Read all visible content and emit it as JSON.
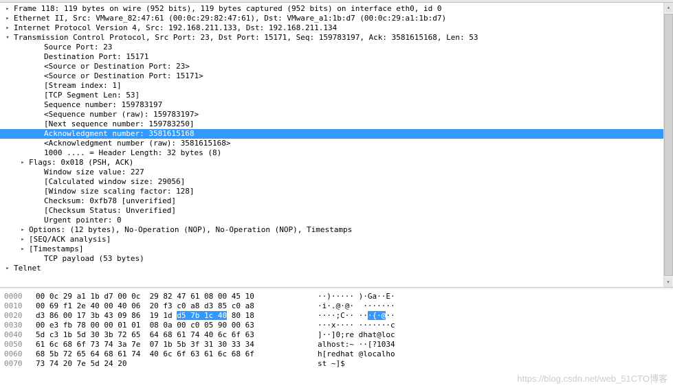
{
  "tree": [
    {
      "indent": 0,
      "toggle": "closed",
      "text": "Frame 118: 119 bytes on wire (952 bits), 119 bytes captured (952 bits) on interface eth0, id 0",
      "interact": true
    },
    {
      "indent": 0,
      "toggle": "closed",
      "text": "Ethernet II, Src: VMware_82:47:61 (00:0c:29:82:47:61), Dst: VMware_a1:1b:d7 (00:0c:29:a1:1b:d7)",
      "interact": true
    },
    {
      "indent": 0,
      "toggle": "closed",
      "text": "Internet Protocol Version 4, Src: 192.168.211.133, Dst: 192.168.211.134",
      "interact": true
    },
    {
      "indent": 0,
      "toggle": "open",
      "text": "Transmission Control Protocol, Src Port: 23, Dst Port: 15171, Seq: 159783197, Ack: 3581615168, Len: 53",
      "interact": true
    },
    {
      "indent": 2,
      "toggle": "none",
      "text": "Source Port: 23",
      "interact": false
    },
    {
      "indent": 2,
      "toggle": "none",
      "text": "Destination Port: 15171",
      "interact": false
    },
    {
      "indent": 2,
      "toggle": "none",
      "text": "<Source or Destination Port: 23>",
      "interact": false
    },
    {
      "indent": 2,
      "toggle": "none",
      "text": "<Source or Destination Port: 15171>",
      "interact": false
    },
    {
      "indent": 2,
      "toggle": "none",
      "text": "[Stream index: 1]",
      "interact": false
    },
    {
      "indent": 2,
      "toggle": "none",
      "text": "[TCP Segment Len: 53]",
      "interact": false
    },
    {
      "indent": 2,
      "toggle": "none",
      "text": "Sequence number: 159783197",
      "interact": false
    },
    {
      "indent": 2,
      "toggle": "none",
      "text": "<Sequence number (raw): 159783197>",
      "interact": false
    },
    {
      "indent": 2,
      "toggle": "none",
      "text": "[Next sequence number: 159783250]",
      "interact": false
    },
    {
      "indent": 2,
      "toggle": "none",
      "text": "Acknowledgment number: 3581615168",
      "selected": true,
      "interact": true
    },
    {
      "indent": 2,
      "toggle": "none",
      "text": "<Acknowledgment number (raw): 3581615168>",
      "interact": false
    },
    {
      "indent": 2,
      "toggle": "none",
      "text": "1000 .... = Header Length: 32 bytes (8)",
      "interact": false
    },
    {
      "indent": 1,
      "toggle": "closed",
      "text": "Flags: 0x018 (PSH, ACK)",
      "interact": true
    },
    {
      "indent": 2,
      "toggle": "none",
      "text": "Window size value: 227",
      "interact": false
    },
    {
      "indent": 2,
      "toggle": "none",
      "text": "[Calculated window size: 29056]",
      "interact": false
    },
    {
      "indent": 2,
      "toggle": "none",
      "text": "[Window size scaling factor: 128]",
      "interact": false
    },
    {
      "indent": 2,
      "toggle": "none",
      "text": "Checksum: 0xfb78 [unverified]",
      "interact": false
    },
    {
      "indent": 2,
      "toggle": "none",
      "text": "[Checksum Status: Unverified]",
      "interact": false
    },
    {
      "indent": 2,
      "toggle": "none",
      "text": "Urgent pointer: 0",
      "interact": false
    },
    {
      "indent": 1,
      "toggle": "closed",
      "text": "Options: (12 bytes), No-Operation (NOP), No-Operation (NOP), Timestamps",
      "interact": true
    },
    {
      "indent": 1,
      "toggle": "closed",
      "text": "[SEQ/ACK analysis]",
      "interact": true
    },
    {
      "indent": 1,
      "toggle": "closed",
      "text": "[Timestamps]",
      "interact": true
    },
    {
      "indent": 2,
      "toggle": "none",
      "text": "TCP payload (53 bytes)",
      "interact": false
    },
    {
      "indent": 0,
      "toggle": "closed",
      "text": "Telnet",
      "interact": true
    }
  ],
  "hex": [
    {
      "offset": "0000",
      "bytes": "00 0c 29 a1 1b d7 00 0c  29 82 47 61 08 00 45 10",
      "ascii": "··)····· )·Ga··E·"
    },
    {
      "offset": "0010",
      "bytes": "00 69 f1 2e 40 00 40 06  20 f3 c0 a8 d3 85 c0 a8",
      "ascii": "·i·.@·@·  ·······"
    },
    {
      "offset": "0020",
      "bytes_pre": "d3 86 00 17 3b 43 09 86  19 1d ",
      "bytes_hl": "d5 7b 1c 40",
      "bytes_post": " 80 18",
      "ascii_pre": "····;C·· ··",
      "ascii_hl": "·{·@",
      "ascii_post": "··"
    },
    {
      "offset": "0030",
      "bytes": "00 e3 fb 78 00 00 01 01  08 0a 00 c0 05 90 00 63",
      "ascii": "···x···· ·······c"
    },
    {
      "offset": "0040",
      "bytes": "5d c3 1b 5d 30 3b 72 65  64 68 61 74 40 6c 6f 63",
      "ascii": "]··]0;re dhat@loc"
    },
    {
      "offset": "0050",
      "bytes": "61 6c 68 6f 73 74 3a 7e  07 1b 5b 3f 31 30 33 34",
      "ascii": "alhost:~ ··[?1034"
    },
    {
      "offset": "0060",
      "bytes": "68 5b 72 65 64 68 61 74  40 6c 6f 63 61 6c 68 6f",
      "ascii": "h[redhat @localho"
    },
    {
      "offset": "0070",
      "bytes": "73 74 20 7e 5d 24 20                            ",
      "ascii": "st ~]$ "
    }
  ],
  "watermark": "https://blog.csdn.net/web_51CTO博客"
}
